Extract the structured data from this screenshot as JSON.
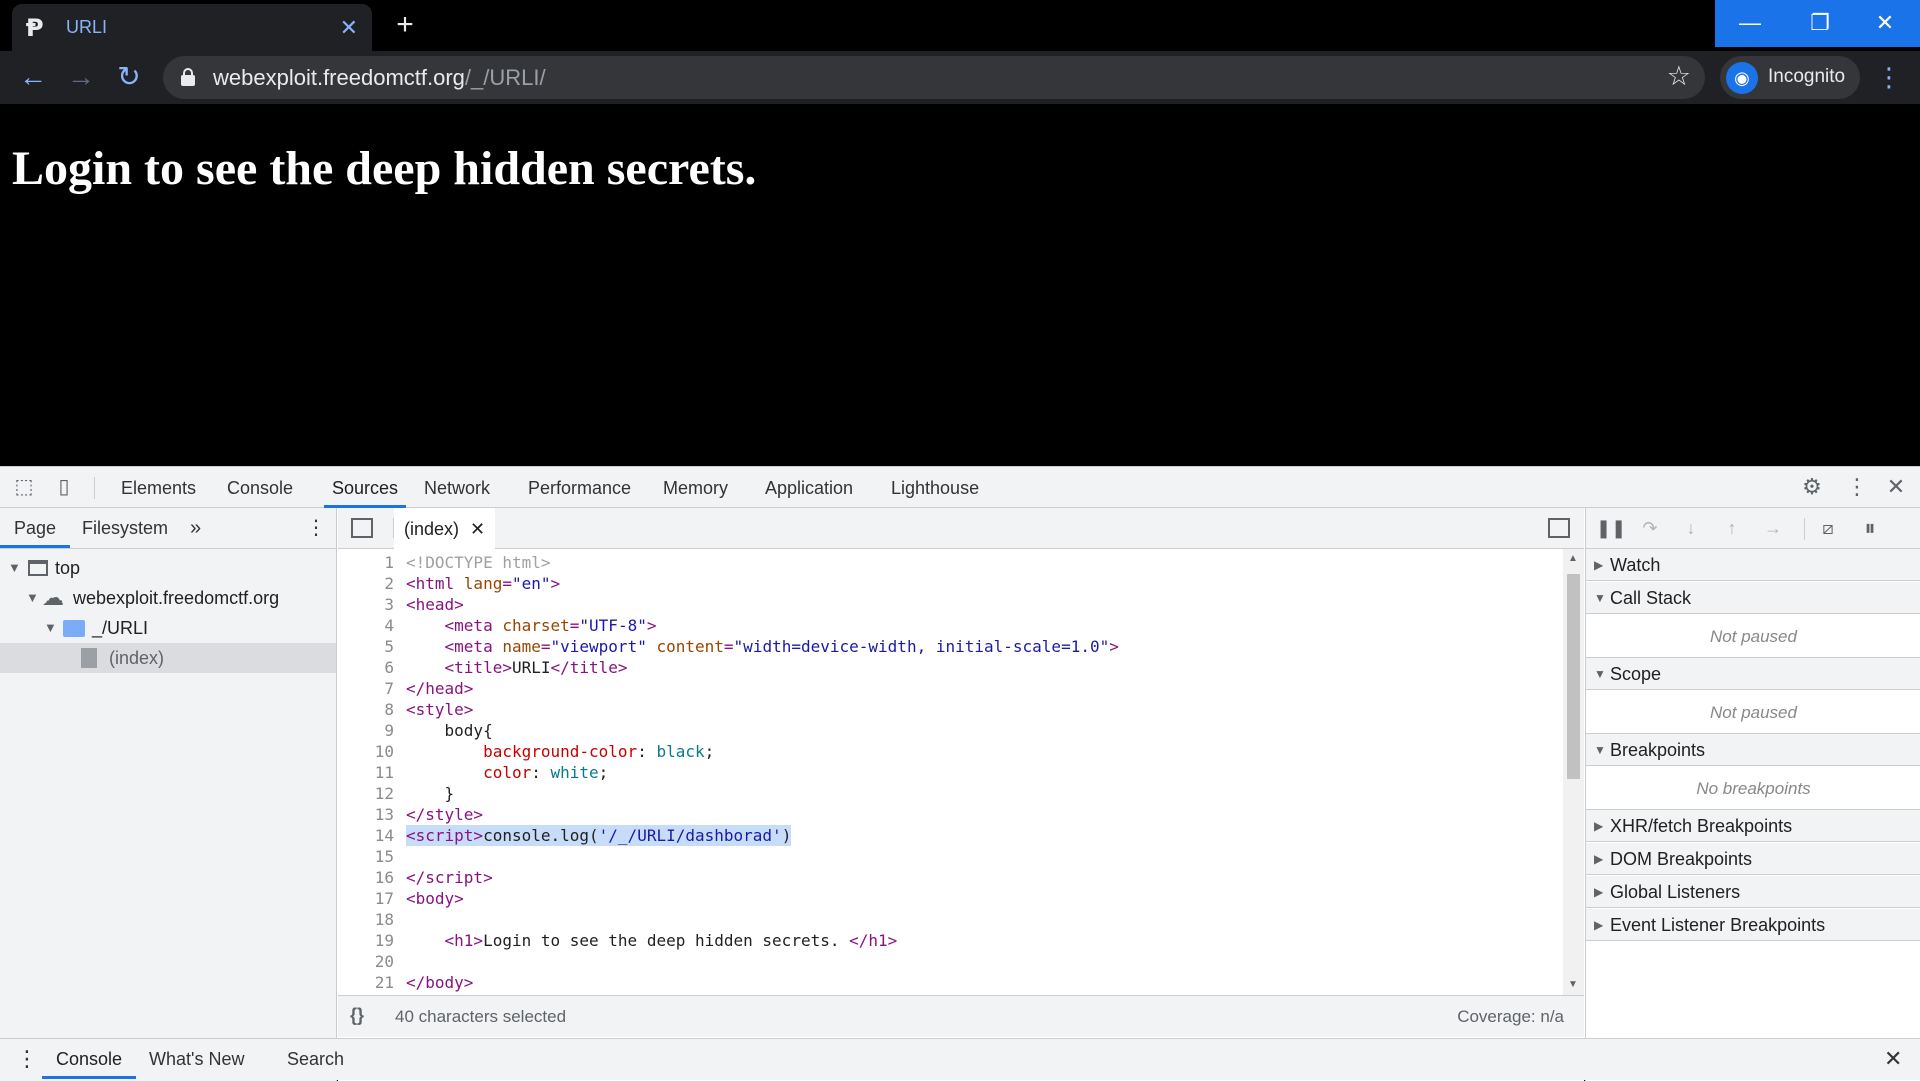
{
  "browser": {
    "tab_title": "URLI",
    "url_host": "webexploit.freedomctf.org",
    "url_path": "/_/URLI/",
    "profile_label": "Incognito"
  },
  "page": {
    "heading": "Login to see the deep hidden secrets."
  },
  "devtools": {
    "tabs": [
      "Elements",
      "Console",
      "Sources",
      "Network",
      "Performance",
      "Memory",
      "Application",
      "Lighthouse"
    ],
    "active_tab": "Sources",
    "navigator": {
      "tabs": [
        "Page",
        "Filesystem"
      ],
      "more": "»",
      "tree": [
        {
          "label": "top"
        },
        {
          "label": "webexploit.freedomctf.org"
        },
        {
          "label": "_/URLI"
        },
        {
          "label": "(index)"
        }
      ]
    },
    "editor": {
      "file_tab": "(index)",
      "lines": [
        "1",
        "2",
        "3",
        "4",
        "5",
        "6",
        "7",
        "8",
        "9",
        "10",
        "11",
        "12",
        "13",
        "14",
        "15",
        "16",
        "17",
        "18",
        "19",
        "20",
        "21"
      ],
      "status_selection": "40 characters selected",
      "status_coverage": "Coverage: n/a",
      "format_icon": "{}"
    },
    "debugger": {
      "sections": {
        "watch": "Watch",
        "call_stack": "Call Stack",
        "call_stack_empty": "Not paused",
        "scope": "Scope",
        "scope_empty": "Not paused",
        "breakpoints": "Breakpoints",
        "breakpoints_empty": "No breakpoints",
        "xhr": "XHR/fetch Breakpoints",
        "dom": "DOM Breakpoints",
        "global": "Global Listeners",
        "event": "Event Listener Breakpoints"
      }
    },
    "drawer": {
      "tabs": [
        "Console",
        "What's New",
        "Search"
      ]
    }
  },
  "colors": {
    "accent": "#1a73e8",
    "tab_text": "#8ab4f8",
    "chrome_bg": "#202124"
  }
}
